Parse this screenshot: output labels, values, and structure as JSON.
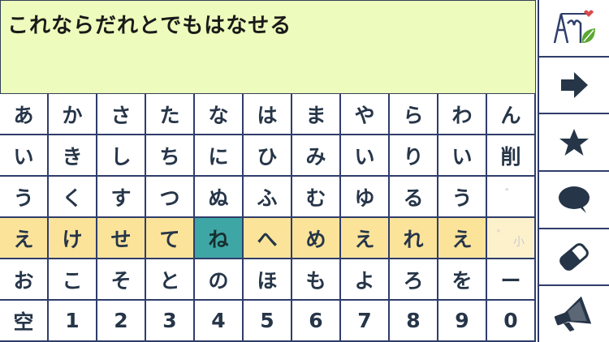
{
  "message": "これならだれとでもはなせる",
  "keys": [
    [
      "あ",
      "か",
      "さ",
      "た",
      "な",
      "は",
      "ま",
      "や",
      "ら",
      "わ",
      "ん"
    ],
    [
      "い",
      "き",
      "し",
      "ち",
      "に",
      "ひ",
      "み",
      "い",
      "り",
      "い",
      "削"
    ],
    [
      "う",
      "く",
      "す",
      "つ",
      "ぬ",
      "ふ",
      "む",
      "ゆ",
      "る",
      "う",
      "゛"
    ],
    [
      "え",
      "け",
      "せ",
      "て",
      "ね",
      "へ",
      "め",
      "え",
      "れ",
      "え",
      "゜"
    ],
    [
      "お",
      "こ",
      "そ",
      "と",
      "の",
      "ほ",
      "も",
      "よ",
      "ろ",
      "を",
      "ー"
    ],
    [
      "空",
      "1",
      "2",
      "3",
      "4",
      "5",
      "6",
      "7",
      "8",
      "9",
      "0"
    ]
  ],
  "small_label": "小",
  "side_buttons": [
    {
      "name": "app-logo-icon",
      "label": ""
    },
    {
      "name": "arrow-right-icon",
      "label": ""
    },
    {
      "name": "star-icon",
      "label": ""
    },
    {
      "name": "speech-bubble-icon",
      "label": ""
    },
    {
      "name": "eraser-icon",
      "label": ""
    },
    {
      "name": "megaphone-icon",
      "label": ""
    }
  ],
  "colors": {
    "textbox_bg": "#edfcbc",
    "highlight_row": "#fbe39a",
    "selected_key": "#3fa6a6",
    "border": "#2f3d6b",
    "key_text": "#263548"
  }
}
